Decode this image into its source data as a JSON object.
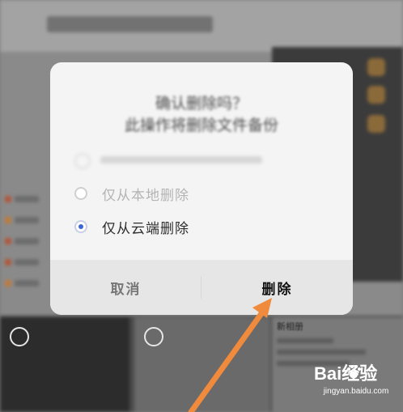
{
  "dialog": {
    "title": "确认删除吗？\n此操作将删除文件备份",
    "options": [
      {
        "label": "仅从本地删除",
        "checked": false,
        "enabled": false
      },
      {
        "label": "仅从云端删除",
        "checked": true,
        "enabled": true
      }
    ],
    "cancel_label": "取消",
    "delete_label": "删除"
  },
  "background": {
    "info_title": "新相册"
  },
  "watermark": {
    "brand_text": "Bai经验",
    "url": "jingyan.baidu.com"
  },
  "colors": {
    "accent": "#3a66d6",
    "arrow": "#f08a3c"
  }
}
